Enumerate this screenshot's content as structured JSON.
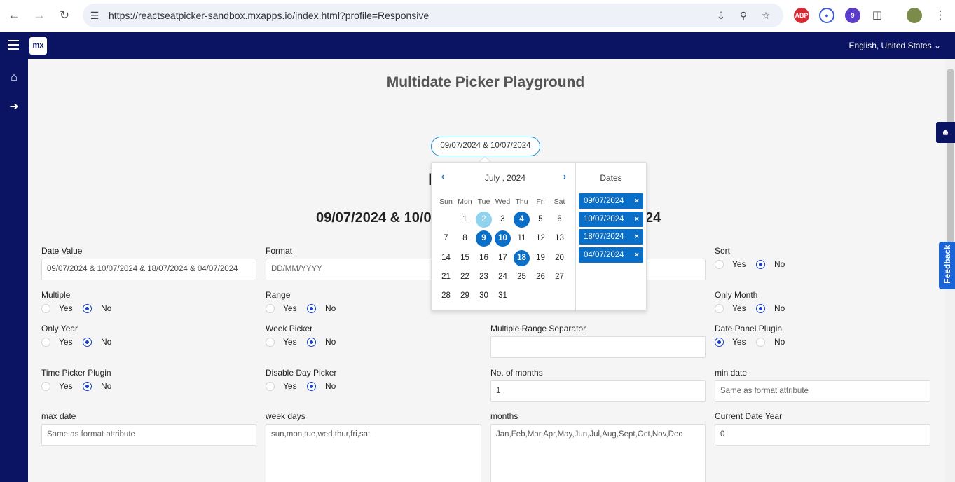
{
  "browser": {
    "url": "https://reactseatpicker-sandbox.mxapps.io/index.html?profile=Responsive",
    "ext_abp": "ABP",
    "ext_badge": "9"
  },
  "topbar": {
    "logo": "mx",
    "language": "English, United States"
  },
  "page": {
    "title": "Multidate Picker Playground",
    "picker_value": "09/07/2024 & 10/07/2024",
    "big_dates_left": "09/07/2024 & 10/0",
    "big_dates_right": "24",
    "feedback": "Feedback"
  },
  "calendar": {
    "month_title": "July , 2024",
    "weekdays": [
      "Sun",
      "Mon",
      "Tue",
      "Wed",
      "Thu",
      "Fri",
      "Sat"
    ],
    "days": [
      "1",
      "2",
      "3",
      "4",
      "5",
      "6",
      "7",
      "8",
      "9",
      "10",
      "11",
      "12",
      "13",
      "14",
      "15",
      "16",
      "17",
      "18",
      "19",
      "20",
      "21",
      "22",
      "23",
      "24",
      "25",
      "26",
      "27",
      "28",
      "29",
      "30",
      "31"
    ],
    "selected": [
      "4",
      "9",
      "10",
      "18"
    ],
    "today": "2",
    "dates_title": "Dates",
    "chips": [
      "09/07/2024",
      "10/07/2024",
      "18/07/2024",
      "04/07/2024"
    ],
    "chip_remove": "×"
  },
  "form": {
    "date_value": {
      "label": "Date Value",
      "value": "09/07/2024 & 10/07/2024 & 18/07/2024 & 04/07/2024"
    },
    "format": {
      "label": "Format",
      "value": "DD/MM/YYYY"
    },
    "sort": {
      "label": "Sort",
      "yes": "Yes",
      "no": "No",
      "selected": "No"
    },
    "multiple": {
      "label": "Multiple",
      "yes": "Yes",
      "no": "No",
      "selected": "No"
    },
    "range": {
      "label": "Range",
      "yes": "Yes",
      "no": "No",
      "selected": "No"
    },
    "only_month": {
      "label": "Only Month",
      "yes": "Yes",
      "no": "No",
      "selected": "No"
    },
    "only_year": {
      "label": "Only Year",
      "yes": "Yes",
      "no": "No",
      "selected": "No"
    },
    "week_picker": {
      "label": "Week Picker",
      "yes": "Yes",
      "no": "No",
      "selected": "No"
    },
    "multiple_range_separator": {
      "label": "Multiple Range Separator",
      "value": ""
    },
    "date_panel_plugin": {
      "label": "Date Panel Plugin",
      "yes": "Yes",
      "no": "No",
      "selected": "Yes"
    },
    "time_picker_plugin": {
      "label": "Time Picker Plugin",
      "yes": "Yes",
      "no": "No",
      "selected": "No"
    },
    "disable_day_picker": {
      "label": "Disable Day Picker",
      "yes": "Yes",
      "no": "No",
      "selected": "No"
    },
    "no_of_months": {
      "label": "No. of months",
      "value": "1"
    },
    "min_date": {
      "label": "min date",
      "placeholder": "Same as format attribute"
    },
    "max_date": {
      "label": "max date",
      "placeholder": "Same as format attribute"
    },
    "week_days": {
      "label": "week days",
      "value": "sun,mon,tue,wed,thur,fri,sat"
    },
    "months": {
      "label": "months",
      "value": "Jan,Feb,Mar,Apr,May,Jun,Jul,Aug,Sept,Oct,Nov,Dec"
    },
    "current_date_year": {
      "label": "Current Date Year",
      "value": "0"
    }
  }
}
